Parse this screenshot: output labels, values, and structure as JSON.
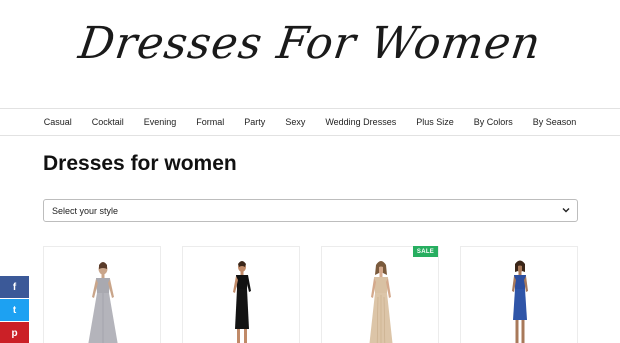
{
  "site": {
    "logo_text": "Dresses For Women"
  },
  "nav": {
    "items": [
      "Casual",
      "Cocktail",
      "Evening",
      "Formal",
      "Party",
      "Sexy",
      "Wedding Dresses",
      "Plus Size",
      "By Colors",
      "By Season"
    ]
  },
  "page": {
    "title": "Dresses for women"
  },
  "style_select": {
    "selected": "Select your style"
  },
  "products": [
    {
      "image": "grey-gown",
      "badge": ""
    },
    {
      "image": "black-one-shoulder-dress",
      "badge": ""
    },
    {
      "image": "champagne-sequin-gown",
      "badge": "SALE"
    },
    {
      "image": "blue-sheath-dress",
      "badge": ""
    }
  ],
  "share": {
    "facebook": "f",
    "twitter": "t",
    "pinterest": "p"
  },
  "colors": {
    "sale_badge": "#27ae60",
    "facebook": "#3b5998",
    "twitter": "#1da1f2",
    "pinterest": "#cb2027"
  }
}
